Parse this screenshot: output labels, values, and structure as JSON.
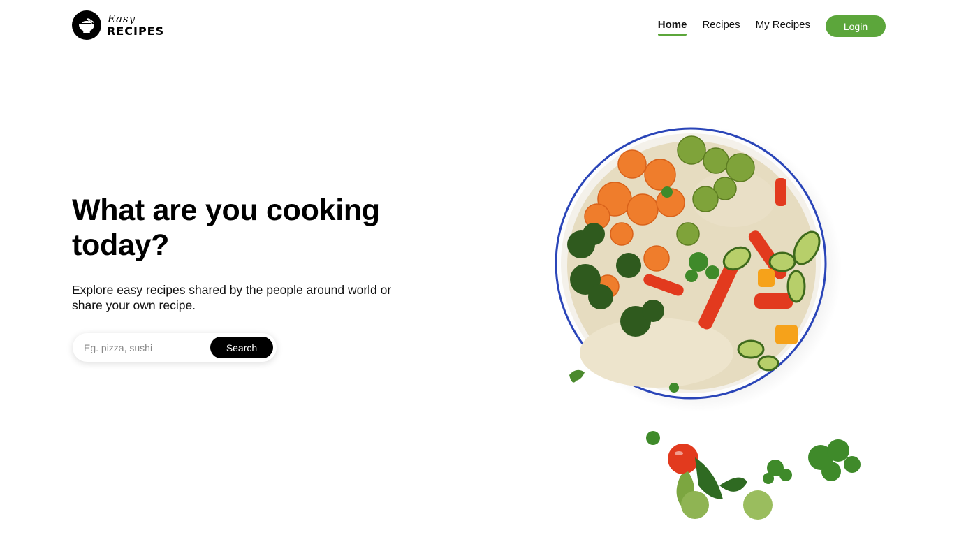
{
  "header": {
    "logo": {
      "top": "Easy",
      "bottom": "RECIPES",
      "icon": "bowl-icon"
    },
    "nav": [
      {
        "label": "Home",
        "active": true
      },
      {
        "label": "Recipes",
        "active": false
      },
      {
        "label": "My Recipes",
        "active": false
      }
    ],
    "login_label": "Login"
  },
  "hero": {
    "title": "What are you cooking today?",
    "subtitle": "Explore easy recipes shared by the people around world or share your own recipe.",
    "search": {
      "placeholder": "Eg. pizza, sushi",
      "value": "",
      "button_label": "Search"
    }
  },
  "colors": {
    "accent": "#5ca63b",
    "text": "#000000",
    "button_dark": "#000000",
    "bowl_rim": "#2a45b8"
  }
}
